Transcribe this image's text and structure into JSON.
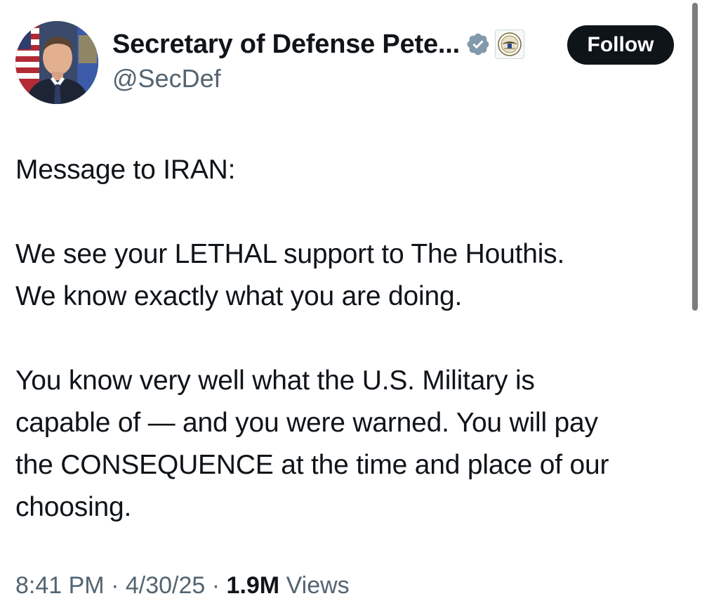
{
  "author": {
    "display_name": "Secretary of Defense Pete...",
    "handle": "@SecDef"
  },
  "icons": {
    "verified": "verified-badge-icon",
    "affiliate": "dod-seal-icon"
  },
  "actions": {
    "follow_label": "Follow"
  },
  "tweet": {
    "line1": "Message to IRAN:",
    "paragraph2": "We see your LETHAL support to The Houthis.\nWe know exactly what you are doing.",
    "paragraph3": "You know very well what the U.S. Military is\ncapable of — and you were warned. You will pay\nthe CONSEQUENCE at the time and place of our\nchoosing."
  },
  "meta": {
    "time": "8:41 PM",
    "separator": "·",
    "date": "4/30/25",
    "views_count": "1.9M",
    "views_label": "Views"
  },
  "colors": {
    "text_primary": "#0f1419",
    "text_secondary": "#536471",
    "verified_gray": "#829aab",
    "follow_bg": "#0f1419"
  }
}
